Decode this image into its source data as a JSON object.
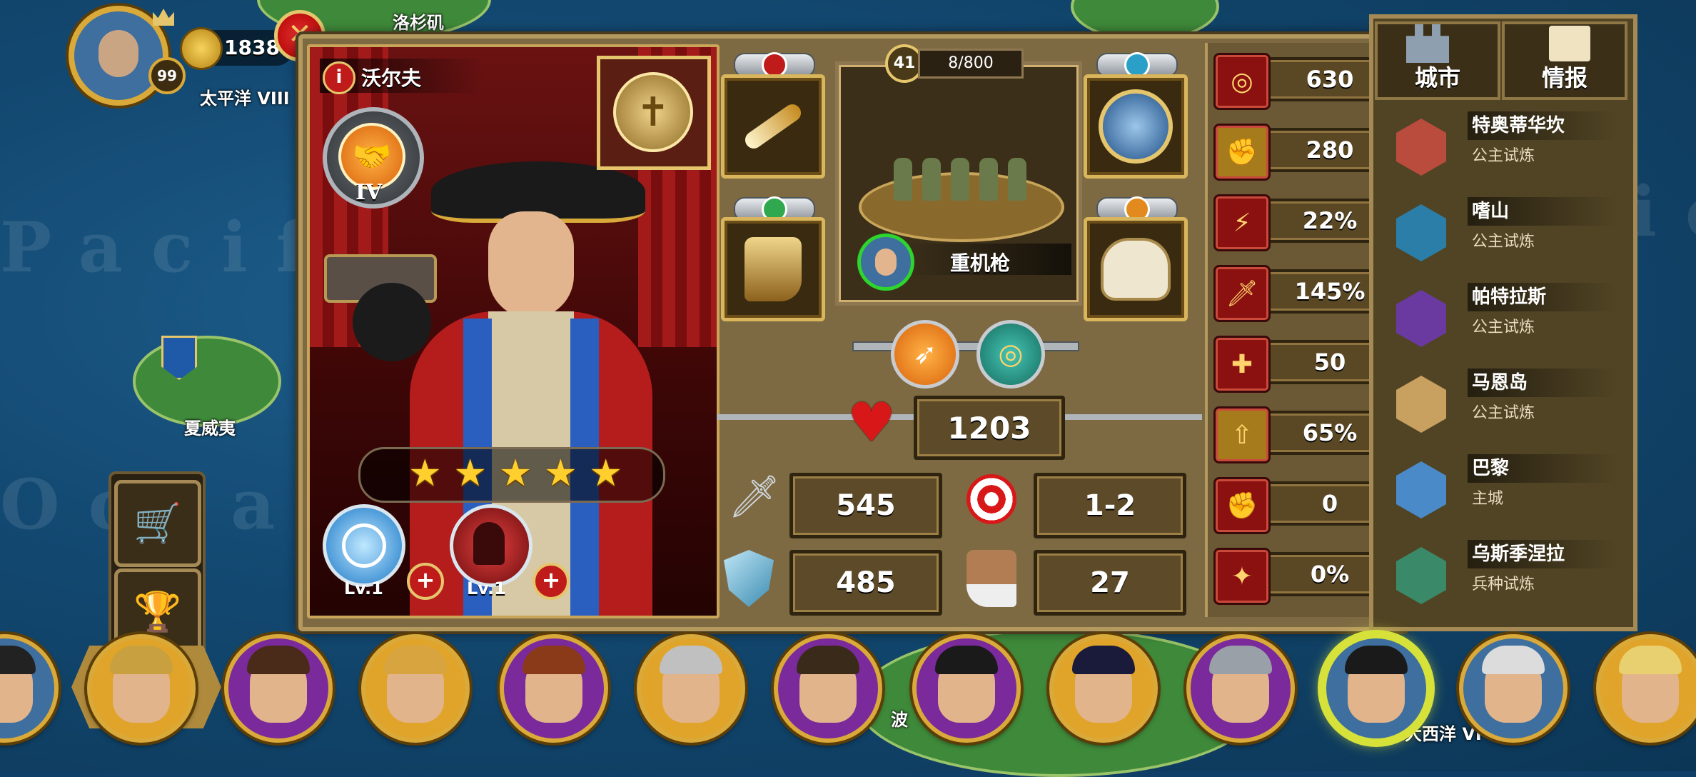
{
  "map": {
    "labels": [
      "洛杉矶",
      "太平洋 VIII",
      "夏威夷",
      "大西洋 VI",
      "波"
    ],
    "watermark": [
      "Pacific",
      "Ocean",
      "tic"
    ]
  },
  "player": {
    "level": "99",
    "gold": "1838"
  },
  "hero": {
    "name": "沃尔夫",
    "rank": "IV",
    "stars": 5,
    "skills": [
      {
        "level": "Lv.1"
      },
      {
        "level": "Lv.1"
      }
    ]
  },
  "unit": {
    "level": "41",
    "exp": "8/800",
    "name": "重机枪"
  },
  "stats": {
    "hp": "1203",
    "attack": "545",
    "range": "1-2",
    "defense": "485",
    "speed": "27"
  },
  "right_stats": [
    "630",
    "280",
    "22%",
    "145%",
    "50",
    "65%",
    "0",
    "0%"
  ],
  "side": {
    "tabs": [
      "城市",
      "情报"
    ],
    "items": [
      {
        "name": "特奥蒂华坎",
        "type": "公主试炼"
      },
      {
        "name": "嗜山",
        "type": "公主试炼"
      },
      {
        "name": "帕特拉斯",
        "type": "公主试炼"
      },
      {
        "name": "马恩岛",
        "type": "公主试炼"
      },
      {
        "name": "巴黎",
        "type": "主城"
      },
      {
        "name": "乌斯季涅拉",
        "type": "兵种试炼"
      }
    ]
  },
  "colors": {
    "panel": "#7d6a43",
    "gold": "#d9b55c",
    "accent_red": "#c01b1b",
    "selected": "#d6e23a"
  }
}
